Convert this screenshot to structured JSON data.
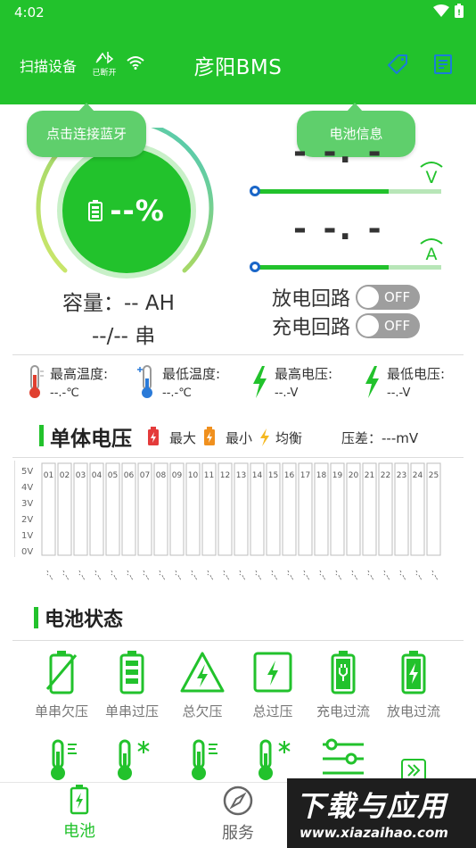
{
  "status_bar": {
    "time": "4:02"
  },
  "header": {
    "scan_label": "扫描设备",
    "bt_state_label": "已断开",
    "title": "彦阳BMS"
  },
  "tooltips": {
    "connect": "点击连接蓝牙",
    "battery_info": "电池信息"
  },
  "soc": {
    "value": "--%"
  },
  "capacity": {
    "text": "容量：-- AH"
  },
  "series": {
    "text": "--/-- 串"
  },
  "voltage_meter": {
    "digits": "- -. -"
  },
  "current_meter": {
    "digits": "- -. -"
  },
  "switches": {
    "discharge": {
      "label": "放电回路",
      "state": "OFF"
    },
    "charge": {
      "label": "充电回路",
      "state": "OFF"
    }
  },
  "stats": [
    {
      "label": "最高温度:",
      "value": "--.-℃"
    },
    {
      "label": "最低温度:",
      "value": "--.-℃"
    },
    {
      "label": "最高电压:",
      "value": "--.-V"
    },
    {
      "label": "最低电压:",
      "value": "--.-V"
    }
  ],
  "cell_voltage": {
    "title": "单体电压",
    "legend_max": "最大",
    "legend_min": "最小",
    "legend_balance": "均衡",
    "diff_label": "压差：---mV"
  },
  "chart_data": {
    "type": "bar",
    "categories": [
      "01",
      "02",
      "03",
      "04",
      "05",
      "06",
      "07",
      "08",
      "09",
      "10",
      "11",
      "12",
      "13",
      "14",
      "15",
      "16",
      "17",
      "18",
      "19",
      "20",
      "21",
      "22",
      "23",
      "24",
      "25"
    ],
    "values": [],
    "value_labels": "-.--",
    "y_ticks": [
      "5V",
      "4V",
      "3V",
      "2V",
      "1V",
      "0V"
    ],
    "ylim": [
      0,
      5
    ]
  },
  "battery_status": {
    "title": "电池状态",
    "items": [
      {
        "label": "单串欠压",
        "icon": "battery-slash-icon"
      },
      {
        "label": "单串过压",
        "icon": "battery-full-icon"
      },
      {
        "label": "总欠压",
        "icon": "warning-bolt-icon"
      },
      {
        "label": "总过压",
        "icon": "square-bolt-icon"
      },
      {
        "label": "充电过流",
        "icon": "battery-plug-icon"
      },
      {
        "label": "放电过流",
        "icon": "battery-bolt-icon"
      }
    ]
  },
  "bottom_nav": {
    "battery": "电池",
    "service": "服务"
  },
  "watermark": {
    "main": "下载与应用",
    "url": "www.xiazaihao.com"
  },
  "colors": {
    "primary": "#22c22c",
    "tooltip": "#5fcf6c",
    "toggle_off": "#9e9e9e",
    "knob_blue": "#1a66c8"
  }
}
